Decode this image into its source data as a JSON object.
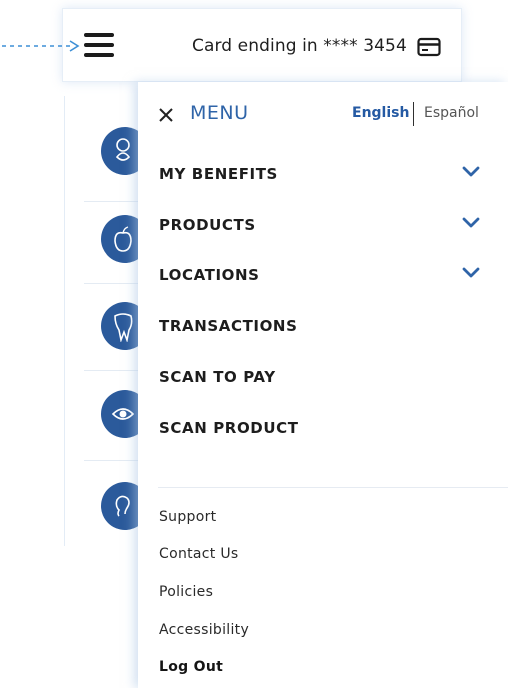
{
  "header": {
    "card_label": "Card ending in **** 3454"
  },
  "menu": {
    "title": "MENU",
    "languages": {
      "english": "English",
      "spanish": "Español"
    },
    "items": [
      {
        "label": "MY BENEFITS",
        "expandable": true
      },
      {
        "label": "PRODUCTS",
        "expandable": true
      },
      {
        "label": "LOCATIONS",
        "expandable": true
      },
      {
        "label": "TRANSACTIONS",
        "expandable": false
      },
      {
        "label": "SCAN TO PAY",
        "expandable": false
      },
      {
        "label": "SCAN PRODUCT",
        "expandable": false
      }
    ],
    "links": [
      {
        "label": "Support"
      },
      {
        "label": "Contact Us"
      },
      {
        "label": "Policies"
      },
      {
        "label": "Accessibility"
      },
      {
        "label": "Log Out"
      }
    ]
  },
  "background_icons": [
    "health-icon",
    "apple-icon",
    "tooth-icon",
    "eye-icon",
    "ear-icon"
  ],
  "colors": {
    "brand_blue": "#2f64a8",
    "circle_blue": "#2b5a9b",
    "text_dark": "#1d1d1d"
  }
}
